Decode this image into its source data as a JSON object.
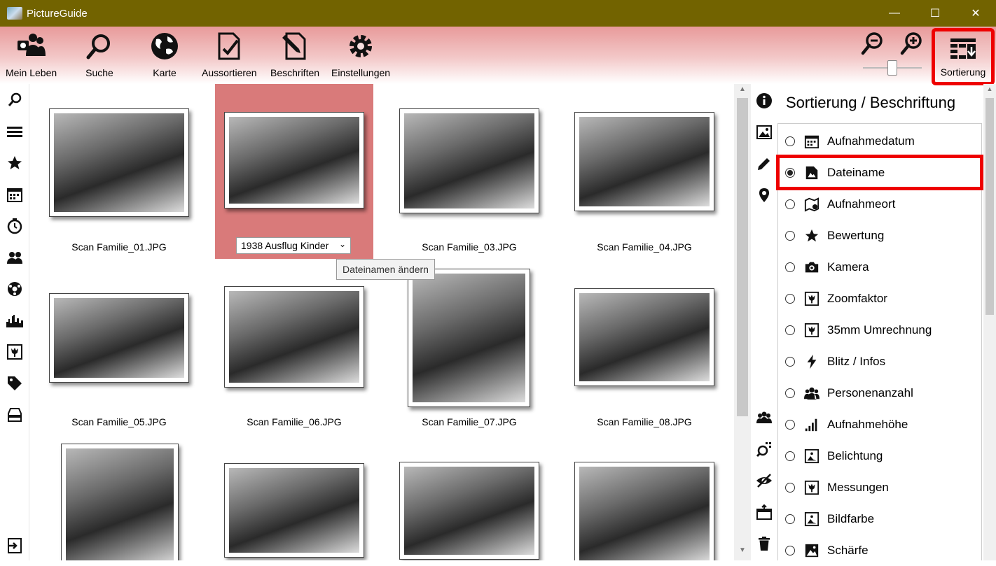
{
  "window": {
    "title": "PictureGuide",
    "controls": [
      "—",
      "☐",
      "✕"
    ]
  },
  "ribbon": {
    "buttons": [
      {
        "label": "Mein Leben",
        "icon": "people-photo-icon"
      },
      {
        "label": "Suche",
        "icon": "search-icon"
      },
      {
        "label": "Karte",
        "icon": "globe-icon"
      },
      {
        "label": "Aussortieren",
        "icon": "document-check-icon"
      },
      {
        "label": "Beschriften",
        "icon": "document-edit-icon"
      },
      {
        "label": "Einstellungen",
        "icon": "gear-icon"
      }
    ],
    "zoom_level": 0.5,
    "sort_label": "Sortierung"
  },
  "left_sidebar": {
    "icons": [
      "search-icon",
      "list-icon",
      "star-icon",
      "calendar-icon",
      "timer-icon",
      "people-icon",
      "ball-icon",
      "skyline-icon",
      "zoom-frame-icon",
      "tag-icon",
      "archive-icon",
      "exit-icon"
    ]
  },
  "grid": {
    "items": [
      {
        "caption": "Scan Familie_01.JPG"
      },
      {
        "caption": "1938 Ausflug Kinder"
      },
      {
        "caption": "Scan Familie_03.JPG"
      },
      {
        "caption": "Scan Familie_04.JPG"
      },
      {
        "caption": "Scan Familie_05.JPG"
      },
      {
        "caption": "Scan Familie_06.JPG"
      },
      {
        "caption": "Scan Familie_07.JPG"
      },
      {
        "caption": "Scan Familie_08.JPG"
      },
      {
        "caption": ""
      },
      {
        "caption": ""
      },
      {
        "caption": ""
      },
      {
        "caption": ""
      }
    ],
    "tooltip": "Dateinamen ändern",
    "selected_index": 1
  },
  "right_strip": {
    "icons": [
      "info-icon",
      "image-landscape-icon",
      "pencil-icon",
      "location-pin-icon",
      "group-icon",
      "similar-search-icon",
      "eye-hidden-icon",
      "export-icon",
      "trash-icon"
    ]
  },
  "sort_panel": {
    "title": "Sortierung / Beschriftung",
    "selected": "Dateiname",
    "options": [
      {
        "label": "Aufnahmedatum",
        "icon": "calendar-icon"
      },
      {
        "label": "Dateiname",
        "icon": "file-image-icon"
      },
      {
        "label": "Aufnahmeort",
        "icon": "map-pin-icon"
      },
      {
        "label": "Bewertung",
        "icon": "star-icon"
      },
      {
        "label": "Kamera",
        "icon": "camera-icon"
      },
      {
        "label": "Zoomfaktor",
        "icon": "zoom-frame-icon"
      },
      {
        "label": "35mm Umrechnung",
        "icon": "zoom-frame-icon"
      },
      {
        "label": "Blitz / Infos",
        "icon": "flash-icon"
      },
      {
        "label": "Personenanzahl",
        "icon": "people-icon"
      },
      {
        "label": "Aufnahmehöhe",
        "icon": "signal-bars-icon"
      },
      {
        "label": "Belichtung",
        "icon": "exposure-icon"
      },
      {
        "label": "Messungen",
        "icon": "zoom-frame-icon"
      },
      {
        "label": "Bildfarbe",
        "icon": "exposure-icon"
      },
      {
        "label": "Schärfe",
        "icon": "landscape-icon"
      }
    ]
  },
  "colors": {
    "title_bar": "#726300",
    "ribbon_top": "#e89a9a",
    "selection": "#d97a7a",
    "highlight": "#ee0000"
  }
}
